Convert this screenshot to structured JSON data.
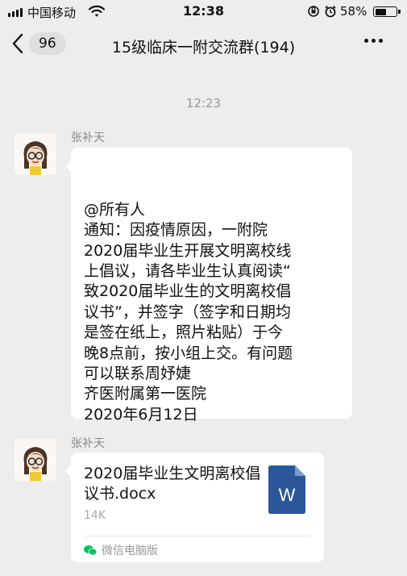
{
  "status_bar": {
    "carrier": "中国移动",
    "time": "12:38",
    "battery_percent": "58%",
    "battery_level": 0.58
  },
  "nav": {
    "unread_count": "96",
    "title": "15级临床一附交流群(194)"
  },
  "timestamp": "12:23",
  "messages": [
    {
      "sender": "张补天",
      "text": "@所有人\n通知：因疫情原因，一附院\n2020届毕业生开展文明离校线\n上倡议，请各毕业生认真阅读“\n致2020届毕业生的文明离校倡\n议书”，并签字（签字和日期均\n是签在纸上，照片粘贴）于今\n晚8点前，按小组上交。有问题\n可以联系周妤婕\n齐医附属第一医院\n2020年6月12日"
    },
    {
      "sender": "张补天",
      "file": {
        "name": "2020届毕业生文明离校倡议书.docx",
        "size": "14K",
        "icon_letter": "W",
        "source": "微信电脑版"
      }
    }
  ],
  "colors": {
    "background": "#ededed",
    "bubble": "#ffffff",
    "word_icon": "#2b579a",
    "wechat_green": "#07c160"
  }
}
